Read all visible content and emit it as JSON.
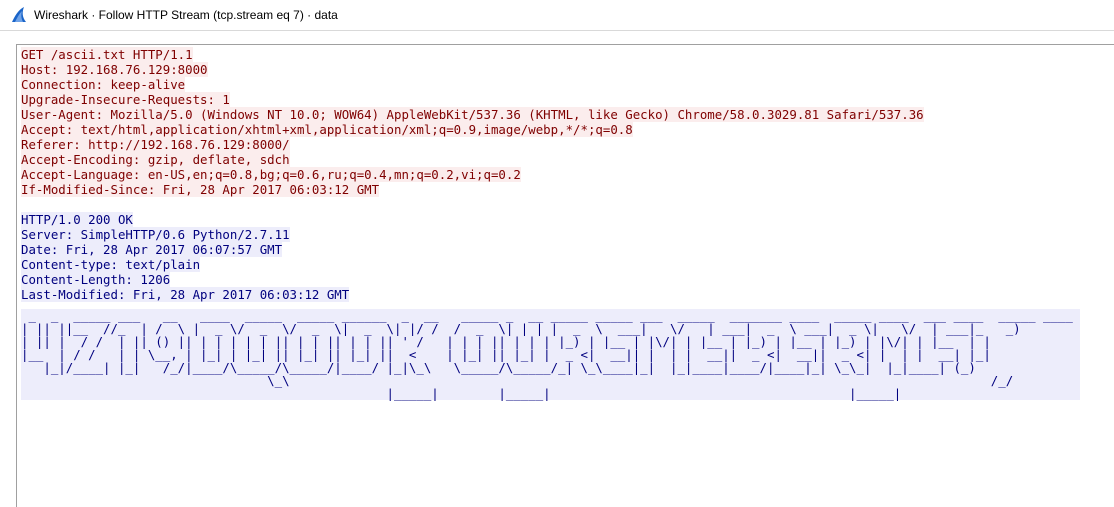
{
  "window": {
    "title": "Wireshark · Follow HTTP Stream (tcp.stream eq 7) · data",
    "icon": "wireshark-fin-icon"
  },
  "colors": {
    "client_fg": "#7f0000",
    "client_bg": "#fbeded",
    "server_fg": "#00007f",
    "server_bg": "#ededfb",
    "accent": "#1a64c8"
  },
  "stream": {
    "request": [
      "GET /ascii.txt HTTP/1.1",
      "Host: 192.168.76.129:8000",
      "Connection: keep-alive",
      "Upgrade-Insecure-Requests: 1",
      "User-Agent: Mozilla/5.0 (Windows NT 10.0; WOW64) AppleWebKit/537.36 (KHTML, like Gecko) Chrome/58.0.3029.81 Safari/537.36",
      "Accept: text/html,application/xhtml+xml,application/xml;q=0.9,image/webp,*/*;q=0.8",
      "Referer: http://192.168.76.129:8000/",
      "Accept-Encoding: gzip, deflate, sdch",
      "Accept-Language: en-US,en;q=0.8,bg;q=0.6,ru;q=0.4,mn;q=0.2,vi;q=0.2",
      "If-Modified-Since: Fri, 28 Apr 2017 06:03:12 GMT"
    ],
    "response": [
      "HTTP/1.0 200 OK",
      "Server: SimpleHTTP/0.6 Python/2.7.11",
      "Date: Fri, 28 Apr 2017 06:07:57 GMT",
      "Content-type: text/plain",
      "Content-Length: 1206",
      "Last-Modified: Fri, 28 Apr 2017 06:03:12 GMT"
    ],
    "ascii_art": [
      " _  _  _____ ___   __   ____  _____  _____ ______  _  __   _____ _  __ _____ _____ ___  _____  _______ ____  _____ ____  ___ ____  _____ ____ ",
      "| || ||__  //_  | /  \\ |  _ \\/  _  \\/  _  \\|  _  \\| |/ /  /  _  \\| | | |  _  \\  ___|   \\/   | ___|  _  \\ ___|  _ \\|   \\/  | ___|_   _) ",
      "| || |  / /  | || () || | | | | | || | | || | | || ' /   | | | || | | | |_) | |__ | |\\/| | |__ | |_) | |__ | |_) | |\\/| | |__  | |  ",
      "|__  | / /   | | \\__, | |_| | |_| || |_| || |_| ||  <    | |_| || |_| |  _ <|  __|| |  | |  __||  _ <|  __||  _ <| |  | |  __| |_|  ",
      "   |_|/____| |_|   /_/|____/\\_____/\\_____/|____/ |_|\\_\\   \\_____/\\_____/_| \\_\\____|_|  |_|____|____/|____|_| \\_\\_|  |_|____| (_)  ",
      "                                 \\_\\                                                                                              /_/   ",
      "                                                 |_____|        |_____|                                        |_____|                  "
    ]
  }
}
